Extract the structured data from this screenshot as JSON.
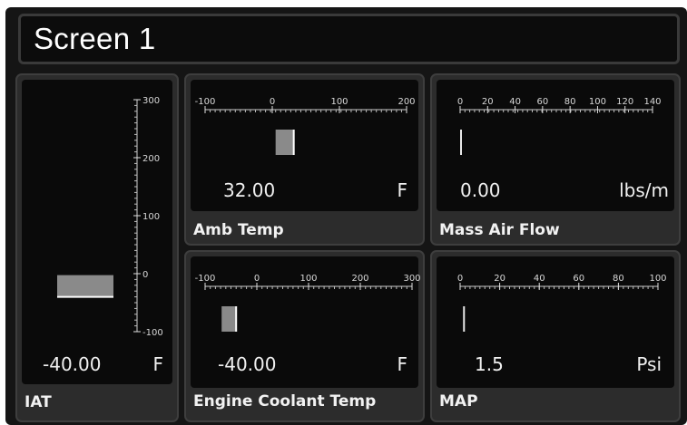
{
  "screen": {
    "title": "Screen 1"
  },
  "colors": {
    "background": "#151515",
    "panel": "#2c2c2c",
    "inner": "#0a0a0a",
    "text": "#f0f0f0",
    "bar": "#8a8a8a"
  },
  "gauges": {
    "iat": {
      "label": "IAT",
      "value": "-40.00",
      "unit": "F",
      "orientation": "vertical",
      "scale_min": -100,
      "scale_max": 300,
      "ticks": [
        "300",
        "200",
        "100",
        "0",
        "-100"
      ],
      "reading": -40
    },
    "amb_temp": {
      "label": "Amb Temp",
      "value": "32.00",
      "unit": "F",
      "orientation": "horizontal",
      "scale_min": -100,
      "scale_max": 200,
      "ticks": [
        "-100",
        "0",
        "100",
        "200"
      ],
      "reading": 32
    },
    "mass_air_flow": {
      "label": "Mass Air Flow",
      "value": "0.00",
      "unit": "lbs/m",
      "orientation": "horizontal",
      "scale_min": 0,
      "scale_max": 140,
      "ticks": [
        "0",
        "20",
        "40",
        "60",
        "80",
        "100",
        "120",
        "140"
      ],
      "reading": 0
    },
    "engine_coolant_temp": {
      "label": "Engine Coolant Temp",
      "value": "-40.00",
      "unit": "F",
      "orientation": "horizontal",
      "scale_min": -100,
      "scale_max": 300,
      "ticks": [
        "-100",
        "0",
        "100",
        "200",
        "300"
      ],
      "reading": -40
    },
    "map": {
      "label": "MAP",
      "value": "1.5",
      "unit": "Psi",
      "orientation": "horizontal",
      "scale_min": 0,
      "scale_max": 100,
      "ticks": [
        "0",
        "20",
        "40",
        "60",
        "80",
        "100"
      ],
      "reading": 1.5
    }
  }
}
